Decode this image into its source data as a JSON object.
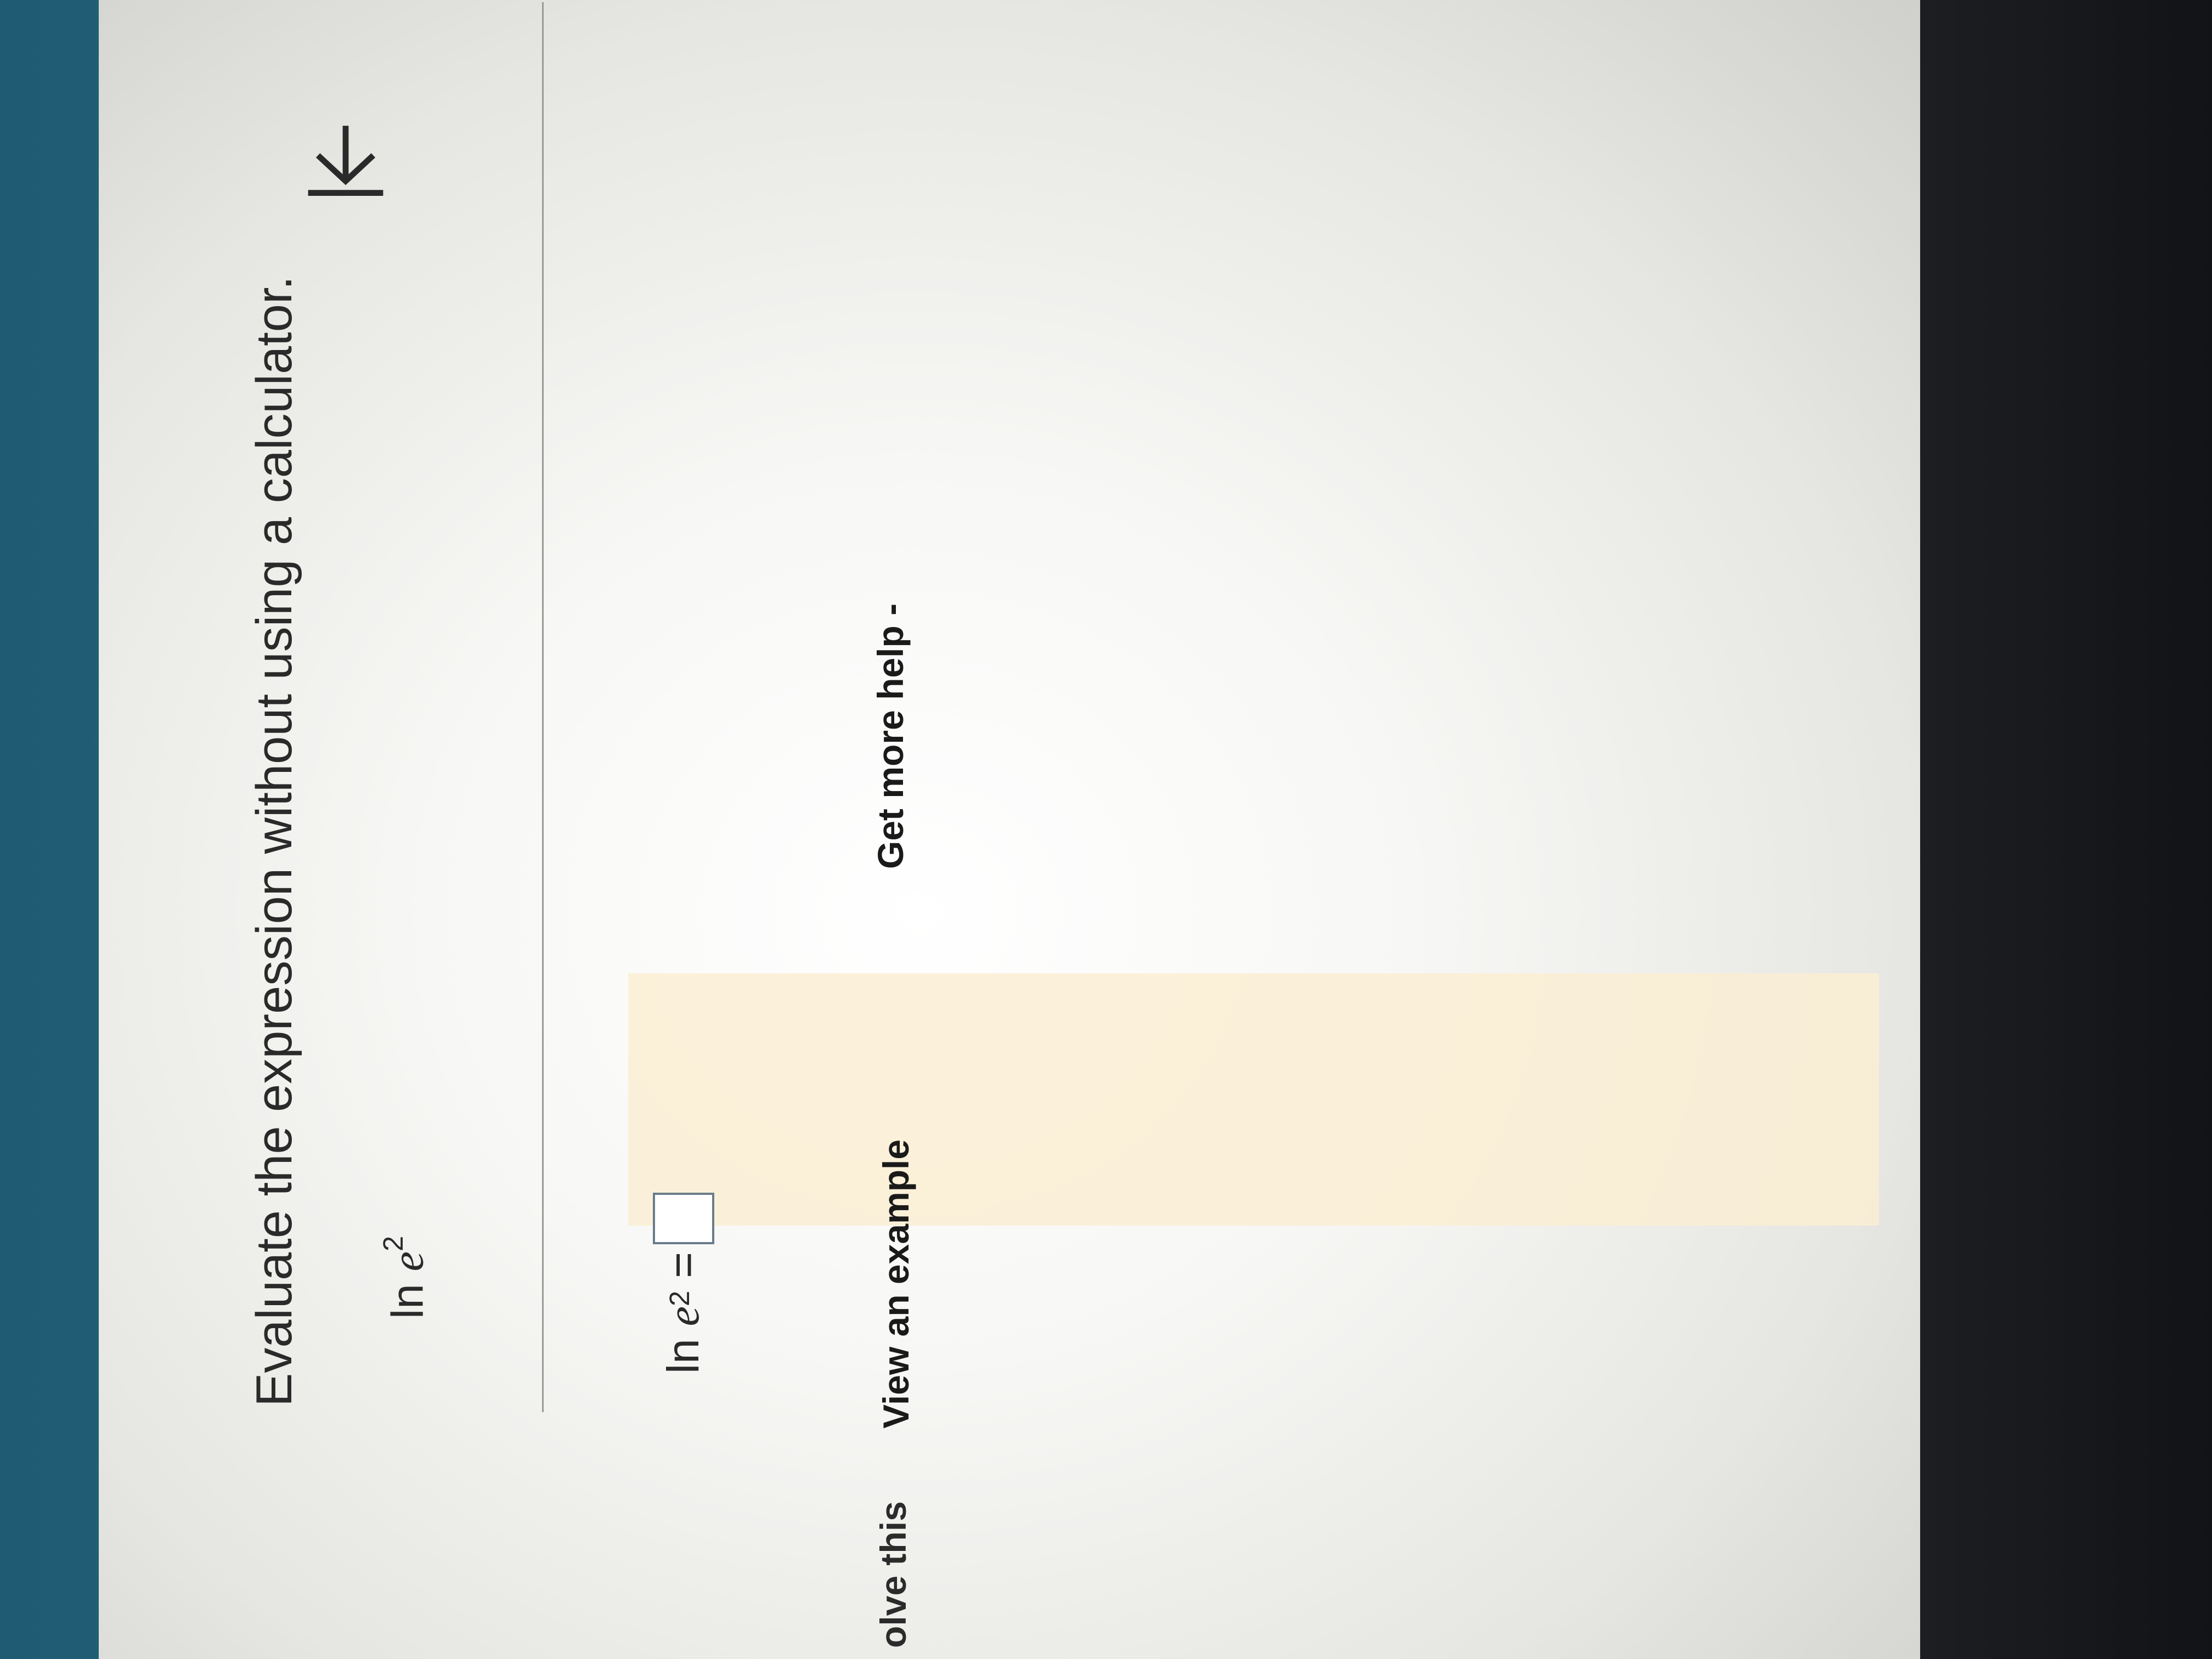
{
  "problem": {
    "instruction": "Evaluate the expression without using a calculator.",
    "expression": {
      "func": "ln",
      "base": "e",
      "exponent": "2"
    },
    "answer_prompt": {
      "func": "ln",
      "base": "e",
      "exponent": "2",
      "equals": "=",
      "value": ""
    }
  },
  "footer": {
    "solve_label": "olve this",
    "example_label": "View an example",
    "help_label": "Get more help -"
  },
  "taskbar": {
    "apps": [
      "chrome-icon",
      "gmail-icon",
      "mail-icon"
    ]
  },
  "colors": {
    "page_background": "#f7f7f5",
    "text": "#2a2a2a",
    "answer_box_border": "#6a7c8a",
    "taskbar": "#121316"
  }
}
